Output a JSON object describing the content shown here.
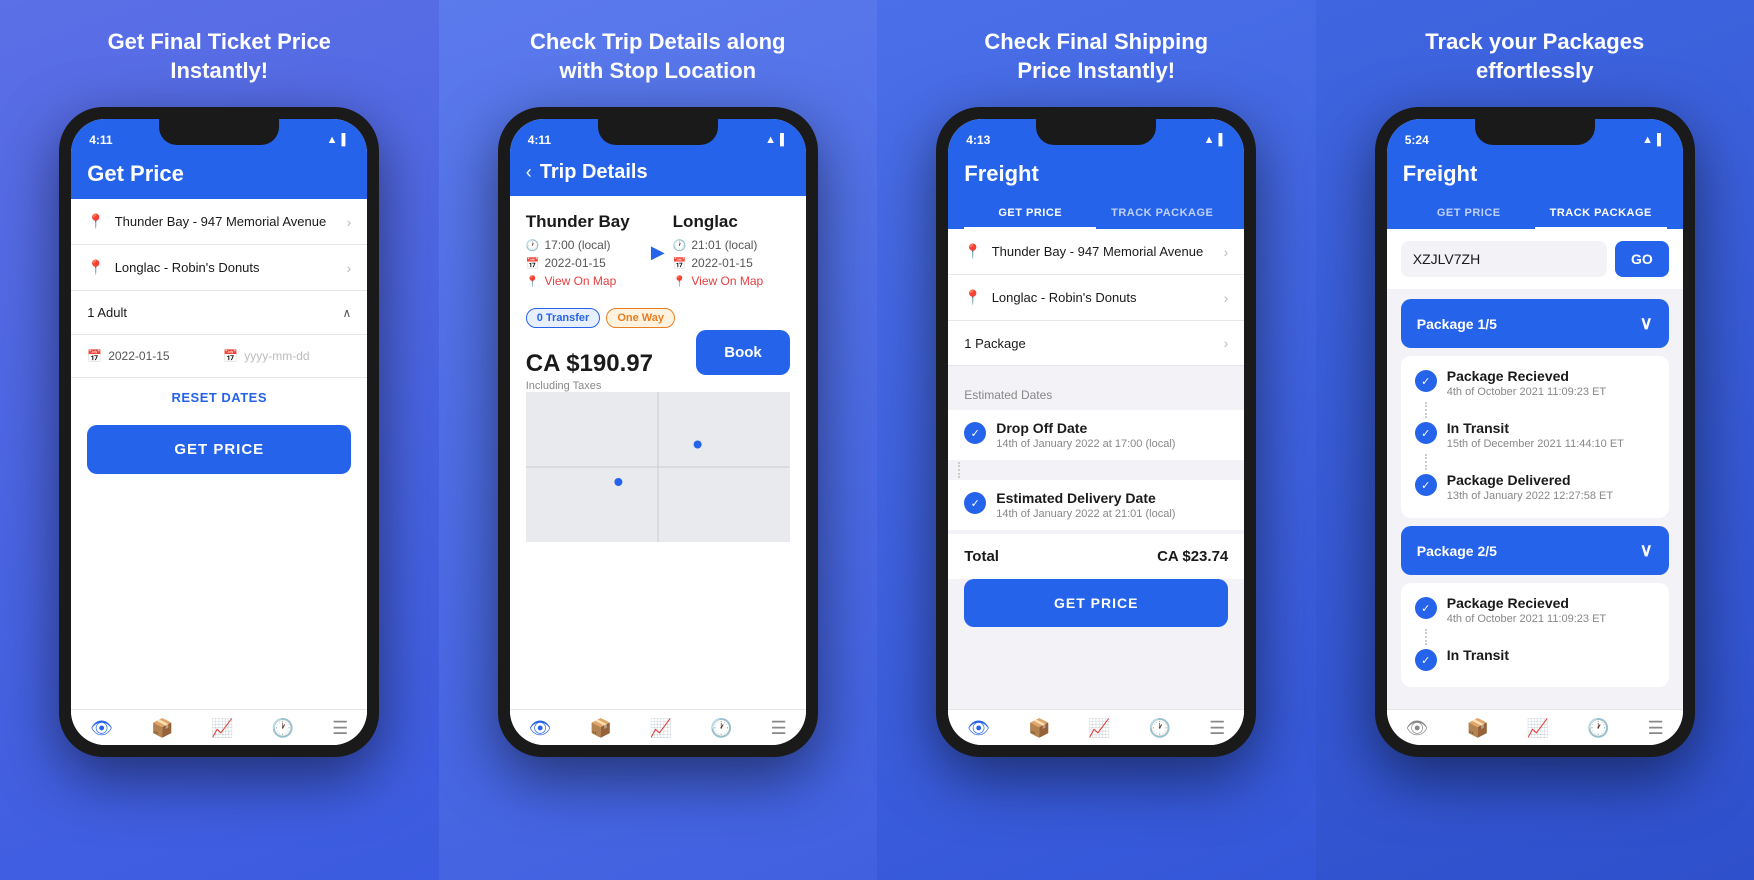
{
  "panels": [
    {
      "id": "panel-1",
      "title": "Get Final Ticket Price\nInstantly!",
      "phone": {
        "status_time": "4:11",
        "header_title": "Get Price",
        "location_1": "Thunder Bay - 947 Memorial Avenue",
        "location_2": "Longlac - Robin's Donuts",
        "passengers": "1 Adult",
        "date_1": "2022-01-15",
        "date_2": "yyyy-mm-dd",
        "reset_label": "RESET DATES",
        "get_price_label": "GET PRICE",
        "nav_icons": [
          "👁",
          "📦",
          "📈",
          "🕐",
          "☰"
        ]
      }
    },
    {
      "id": "panel-2",
      "title": "Check Trip Details along\nwith Stop Location",
      "phone": {
        "status_time": "4:11",
        "header_back": "‹",
        "header_title": "Trip Details",
        "origin_city": "Thunder Bay",
        "origin_time": "17:00 (local)",
        "origin_date": "2022-01-15",
        "origin_map": "View On Map",
        "dest_city": "Longlac",
        "dest_time": "21:01 (local)",
        "dest_date": "2022-01-15",
        "dest_map": "View On Map",
        "tag_1": "0 Transfer",
        "tag_2": "One Way",
        "price": "CA $190.97",
        "price_tax": "Including Taxes",
        "book_label": "Book",
        "nav_icons": [
          "👁",
          "📦",
          "📈",
          "🕐",
          "☰"
        ]
      }
    },
    {
      "id": "panel-3",
      "title": "Check Final Shipping\nPrice Instantly!",
      "phone": {
        "status_time": "4:13",
        "header_title": "Freight",
        "tab_1": "GET PRICE",
        "tab_2": "TRACK PACKAGE",
        "location_1": "Thunder Bay - 947 Memorial Avenue",
        "location_2": "Longlac - Robin's Donuts",
        "packages": "1 Package",
        "estimated_label": "Estimated Dates",
        "dropoff_title": "Drop Off Date",
        "dropoff_date": "14th of January 2022 at 17:00 (local)",
        "delivery_title": "Estimated Delivery Date",
        "delivery_date": "14th of January 2022 at 21:01 (local)",
        "total_label": "Total",
        "total_amount": "CA $23.74",
        "get_price_label": "GET PRICE",
        "nav_icons": [
          "👁",
          "📦",
          "📈",
          "🕐",
          "☰"
        ]
      }
    },
    {
      "id": "panel-4",
      "title": "Track your Packages\neffortlessly",
      "phone": {
        "status_time": "5:24",
        "header_title": "Freight",
        "tab_1": "GET PRICE",
        "tab_2": "TRACK PACKAGE",
        "tracking_placeholder": "XZJLV7ZH",
        "go_label": "GO",
        "package_1": "Package 1/5",
        "event_1_title": "Package Recieved",
        "event_1_date": "4th of October 2021 11:09:23 ET",
        "event_2_title": "In Transit",
        "event_2_date": "15th of December 2021 11:44:10 ET",
        "event_3_title": "Package Delivered",
        "event_3_date": "13th of January 2022 12:27:58 ET",
        "package_2": "Package 2/5",
        "event_4_title": "Package Recieved",
        "event_4_date": "4th of October 2021 11:09:23 ET",
        "event_5_title": "In Transit",
        "nav_icons": [
          "👁",
          "📦",
          "📈",
          "🕐",
          "☰"
        ]
      }
    }
  ]
}
